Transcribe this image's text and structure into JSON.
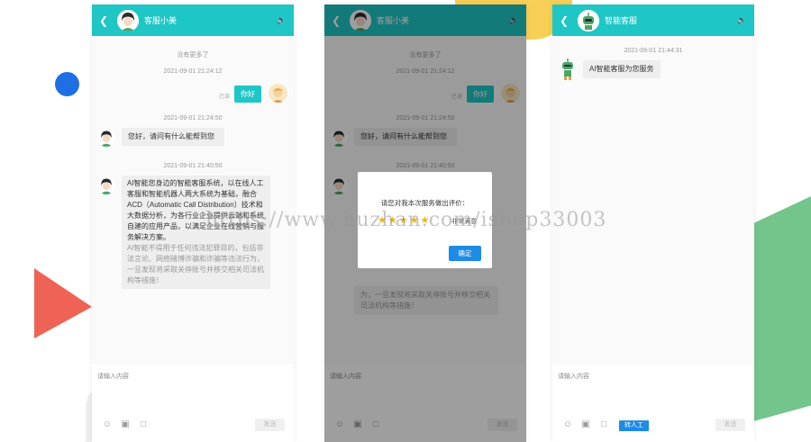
{
  "colors": {
    "header": "#1fc6c6",
    "user_bubble": "#1fc6c6",
    "primary_button": "#1e8be6",
    "star": "#f5b400"
  },
  "panels": [
    {
      "header": {
        "back_icon": "chevron-left-icon",
        "title": "客服小美",
        "speaker_icon": "speaker-icon"
      },
      "no_more": "没有更多了",
      "messages": [
        {
          "time": "2021-09-01 21:24:12",
          "from": "user",
          "text": "你好",
          "status": "已读"
        },
        {
          "time": "2021-09-01 21:24:50",
          "from": "agent",
          "text": "您好，请问有什么能帮到您"
        },
        {
          "time": "2021-09-01 21:40:50",
          "from": "agent",
          "text": "AI智能您身边的智能客服系统，以在线人工客服和智能机器人两大系统为基础，融合ACD（Automatic Call Distribution）技术和大数据分析，为各行业企业提供云端和系统自建的应用产品，以满足企业在线营销与服务解决方案。",
          "warning": "AI智能不得用于任何违法犯罪目的，包括非法言论、网络赌博诈骗和诈骗等违法行为，一旦发现将采取关停账号并移交相关司法机构等措施！"
        }
      ],
      "input": {
        "placeholder": "请输入内容",
        "send_label": "发送"
      }
    },
    {
      "header": {
        "title": "客服小美"
      },
      "no_more": "没有更多了",
      "messages": [
        {
          "time": "2021-09-01 21:24:12",
          "text": "你好",
          "status": "已读"
        },
        {
          "time": "2021-09-01 21:24:50",
          "text": "您好，请问有什么能帮到您"
        },
        {
          "time": "2021-09-01 21:40:50",
          "text_tail": "为，一旦发现将采取关停账号并移交相关司法机构等措施！"
        }
      ],
      "dialog": {
        "title": "请您对我本次服务做出评价：",
        "stars": 5,
        "rating_label": "非常满意",
        "ok_label": "确定"
      },
      "input": {
        "placeholder": "请输入内容",
        "send_label": "发送"
      }
    },
    {
      "header": {
        "title": "智能客服"
      },
      "messages": [
        {
          "time": "2021-09-01 21:44:31",
          "from": "bot",
          "text": "AI智能客服为您服务"
        }
      ],
      "input": {
        "placeholder": "请输入内容",
        "transfer_label": "转人工",
        "send_label": "发送"
      }
    }
  ],
  "watermark": "https://www.huzhan.com/ishop33003"
}
